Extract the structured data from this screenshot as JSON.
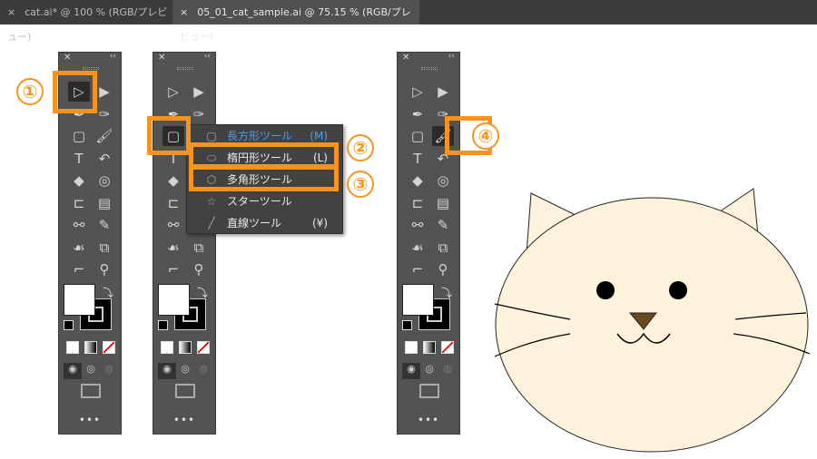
{
  "tabs": [
    {
      "label": "cat.ai* @ 100 % (RGB/プレビュー)",
      "close": "×"
    },
    {
      "label": "05_01_cat_sample.ai @ 75.15 % (RGB/プレビュー)",
      "close": "×"
    }
  ],
  "toolbar": {
    "close": "✕",
    "collapse": "‹‹",
    "more": "•••",
    "tools": [
      [
        "selection-icon",
        "direct-selection-icon"
      ],
      [
        "pen-icon",
        "curvature-icon"
      ],
      [
        "rectangle-icon",
        "paintbrush-icon"
      ],
      [
        "type-icon",
        "rotate-icon"
      ],
      [
        "eraser-icon",
        "shape-builder-icon"
      ],
      [
        "free-transform-icon",
        "gradient-icon"
      ],
      [
        "blend-icon",
        "eyedropper-icon"
      ],
      [
        "symbol-sprayer-icon",
        "live-paint-icon"
      ],
      [
        "artboard-icon",
        "zoom-icon"
      ]
    ]
  },
  "toolbars": [
    {
      "selected": "selection-icon"
    },
    {
      "selected": "rectangle-icon"
    },
    {
      "selected": "paintbrush-icon"
    }
  ],
  "flyout": {
    "items": [
      {
        "icon": "rectangle-icon",
        "label": "長方形ツール",
        "shortcut": "(M)",
        "active": true
      },
      {
        "icon": "ellipse-icon",
        "label": "楕円形ツール",
        "shortcut": "(L)"
      },
      {
        "icon": "polygon-icon",
        "label": "多角形ツール",
        "shortcut": ""
      },
      {
        "icon": "star-icon",
        "label": "スターツール",
        "shortcut": ""
      },
      {
        "icon": "line-icon",
        "label": "直線ツール",
        "shortcut": "(¥)"
      }
    ]
  },
  "callouts": [
    "①",
    "②",
    "③",
    "④"
  ],
  "colors": {
    "highlight": "#f7941d",
    "menu_active": "#4aa0e8",
    "cat_fill": "#fdf3dc",
    "nose": "#6b4a1e"
  }
}
